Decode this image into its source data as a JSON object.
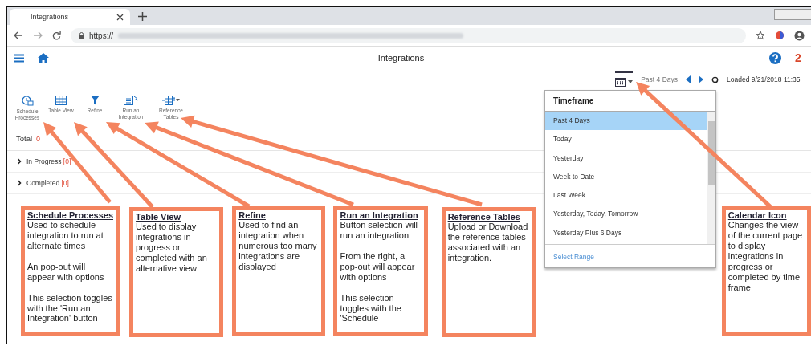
{
  "browser": {
    "tab_title": "Integrations",
    "url": "https://"
  },
  "app_header": {
    "title": "Integrations",
    "badge": "2"
  },
  "timeframe_bar": {
    "current": "Past 4 Days",
    "loaded": "Loaded 9/21/2018 11:35"
  },
  "toolbar": [
    {
      "kind": "schedule",
      "label": "Schedule Processes"
    },
    {
      "kind": "table",
      "label": "Table View"
    },
    {
      "kind": "refine",
      "label": "Refine"
    },
    {
      "kind": "run",
      "label": "Run an Integration"
    },
    {
      "kind": "reference",
      "label": "Reference Tables"
    }
  ],
  "total": {
    "label": "Total",
    "count": "0"
  },
  "sections": [
    {
      "label": "In Progress",
      "count": "[0]",
      "expanded": false
    },
    {
      "label": "Completed",
      "count": "[0]",
      "expanded": false
    }
  ],
  "dropdown": {
    "title": "Timeframe",
    "items": [
      {
        "label": "Past 4 Days",
        "selected": true
      },
      {
        "label": "Today",
        "selected": false
      },
      {
        "label": "Yesterday",
        "selected": false
      },
      {
        "label": "Week to Date",
        "selected": false
      },
      {
        "label": "Last Week",
        "selected": false
      },
      {
        "label": "Yesterday, Today, Tomorrow",
        "selected": false
      },
      {
        "label": "Yesterday Plus 6 Days",
        "selected": false
      }
    ],
    "footer": "Select Range"
  },
  "annotations": [
    {
      "title": "Schedule Processes",
      "paragraphs": [
        "Used to schedule integration to run at alternate times",
        "An pop-out will appear with options",
        "This selection toggles with the 'Run an Integration' button"
      ]
    },
    {
      "title": "Table View",
      "paragraphs": [
        "Used to display integrations in progress or completed with an alternative view"
      ]
    },
    {
      "title": "Refine",
      "paragraphs": [
        "Used to find an integration when numerous too many integrations are displayed"
      ]
    },
    {
      "title": "Run an Integration",
      "paragraphs": [
        "Button selection will run an integration",
        "From the right, a pop-out will appear with options",
        "This selection toggles with the 'Schedule"
      ]
    },
    {
      "title": "Reference Tables",
      "paragraphs": [
        "Upload or Download the reference tables associated with an integration."
      ]
    },
    {
      "title": "Calendar Icon",
      "paragraphs": [
        "Changes the view of the current page to display integrations in progress or completed by time frame"
      ]
    }
  ]
}
